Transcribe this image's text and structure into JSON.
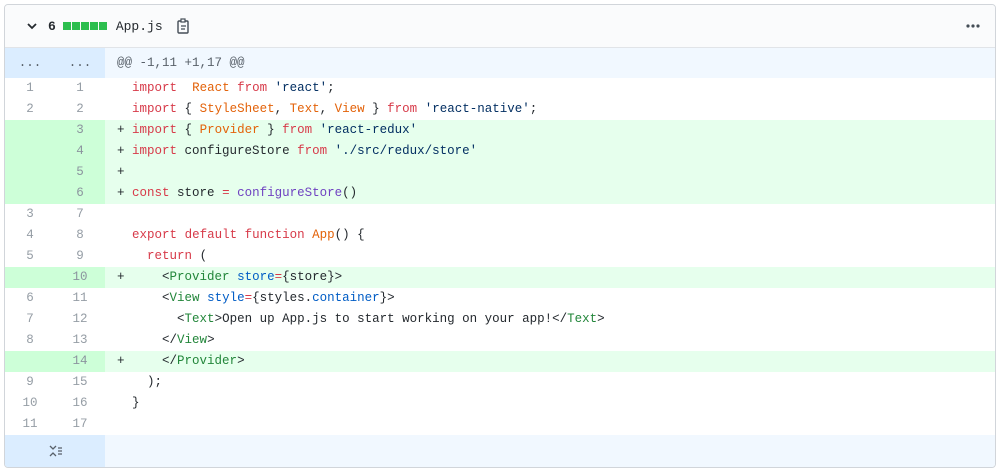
{
  "file": {
    "change_count": "6",
    "filename": "App.js",
    "diffstat_blocks": 5,
    "colors": {
      "added_block": "#2cbe4e",
      "added_row": "#e6ffed",
      "added_gutter": "#cdffd8",
      "hunk_bg": "#f1f8ff"
    }
  },
  "hunk": {
    "old_marker": "...",
    "new_marker": "...",
    "header": "@@ -1,11 +1,17 @@"
  },
  "lines": [
    {
      "old": "1",
      "new": "1",
      "sign": " ",
      "type": "context",
      "tokens": [
        [
          "kw",
          "import"
        ],
        [
          "",
          "  "
        ],
        [
          "ent",
          "React"
        ],
        [
          "",
          " "
        ],
        [
          "kw",
          "from"
        ],
        [
          "",
          " "
        ],
        [
          "str",
          "'react'"
        ],
        [
          "",
          ";"
        ]
      ]
    },
    {
      "old": "2",
      "new": "2",
      "sign": " ",
      "type": "context",
      "tokens": [
        [
          "kw",
          "import"
        ],
        [
          "",
          " { "
        ],
        [
          "ent",
          "StyleSheet"
        ],
        [
          "",
          ", "
        ],
        [
          "ent",
          "Text"
        ],
        [
          "",
          ", "
        ],
        [
          "ent",
          "View"
        ],
        [
          "",
          " } "
        ],
        [
          "kw",
          "from"
        ],
        [
          "",
          " "
        ],
        [
          "str",
          "'react-native'"
        ],
        [
          "",
          ";"
        ]
      ]
    },
    {
      "old": "",
      "new": "3",
      "sign": "+",
      "type": "add",
      "tokens": [
        [
          "kw",
          "import"
        ],
        [
          "",
          " { "
        ],
        [
          "ent",
          "Provider"
        ],
        [
          "",
          " } "
        ],
        [
          "kw",
          "from"
        ],
        [
          "",
          " "
        ],
        [
          "str",
          "'react-redux'"
        ]
      ]
    },
    {
      "old": "",
      "new": "4",
      "sign": "+",
      "type": "add",
      "tokens": [
        [
          "kw",
          "import"
        ],
        [
          "",
          " configureStore "
        ],
        [
          "kw",
          "from"
        ],
        [
          "",
          " "
        ],
        [
          "str",
          "'./src/redux/store'"
        ]
      ]
    },
    {
      "old": "",
      "new": "5",
      "sign": "+",
      "type": "add",
      "tokens": []
    },
    {
      "old": "",
      "new": "6",
      "sign": "+",
      "type": "add",
      "tokens": [
        [
          "kw",
          "const"
        ],
        [
          "",
          " store "
        ],
        [
          "op",
          "="
        ],
        [
          "",
          " "
        ],
        [
          "fn",
          "configureStore"
        ],
        [
          "",
          "()"
        ]
      ]
    },
    {
      "old": "3",
      "new": "7",
      "sign": " ",
      "type": "context",
      "tokens": []
    },
    {
      "old": "4",
      "new": "8",
      "sign": " ",
      "type": "context",
      "tokens": [
        [
          "kw",
          "export"
        ],
        [
          "",
          " "
        ],
        [
          "kw",
          "default"
        ],
        [
          "",
          " "
        ],
        [
          "kw",
          "function"
        ],
        [
          "",
          " "
        ],
        [
          "ent",
          "App"
        ],
        [
          "",
          "() {"
        ]
      ]
    },
    {
      "old": "5",
      "new": "9",
      "sign": " ",
      "type": "context",
      "tokens": [
        [
          "",
          "  "
        ],
        [
          "kw",
          "return"
        ],
        [
          "",
          " ("
        ]
      ]
    },
    {
      "old": "",
      "new": "10",
      "sign": "+",
      "type": "add",
      "tokens": [
        [
          "",
          "    <"
        ],
        [
          "tag",
          "Provider"
        ],
        [
          "",
          " "
        ],
        [
          "attr",
          "store"
        ],
        [
          "op",
          "="
        ],
        [
          "",
          "{store}>"
        ]
      ]
    },
    {
      "old": "6",
      "new": "11",
      "sign": " ",
      "type": "context",
      "tokens": [
        [
          "",
          "    <"
        ],
        [
          "tag",
          "View"
        ],
        [
          "",
          " "
        ],
        [
          "attr",
          "style"
        ],
        [
          "op",
          "="
        ],
        [
          "",
          "{styles."
        ],
        [
          "attr",
          "container"
        ],
        [
          "",
          "}>"
        ]
      ]
    },
    {
      "old": "7",
      "new": "12",
      "sign": " ",
      "type": "context",
      "tokens": [
        [
          "",
          "      <"
        ],
        [
          "tag",
          "Text"
        ],
        [
          "",
          ">Open up App.js to start working on your app!</"
        ],
        [
          "tag",
          "Text"
        ],
        [
          "",
          ">"
        ]
      ]
    },
    {
      "old": "8",
      "new": "13",
      "sign": " ",
      "type": "context",
      "tokens": [
        [
          "",
          "    </"
        ],
        [
          "tag",
          "View"
        ],
        [
          "",
          ">"
        ]
      ]
    },
    {
      "old": "",
      "new": "14",
      "sign": "+",
      "type": "add",
      "tokens": [
        [
          "",
          "    </"
        ],
        [
          "tag",
          "Provider"
        ],
        [
          "",
          ">"
        ]
      ]
    },
    {
      "old": "9",
      "new": "15",
      "sign": " ",
      "type": "context",
      "tokens": [
        [
          "",
          "  );"
        ]
      ]
    },
    {
      "old": "10",
      "new": "16",
      "sign": " ",
      "type": "context",
      "tokens": [
        [
          "",
          "}"
        ]
      ]
    },
    {
      "old": "11",
      "new": "17",
      "sign": " ",
      "type": "context",
      "tokens": []
    }
  ],
  "icons": {
    "collapse": "chevron-down-icon",
    "copy": "clipboard-icon",
    "more": "kebab-icon",
    "expand": "unfold-icon"
  }
}
